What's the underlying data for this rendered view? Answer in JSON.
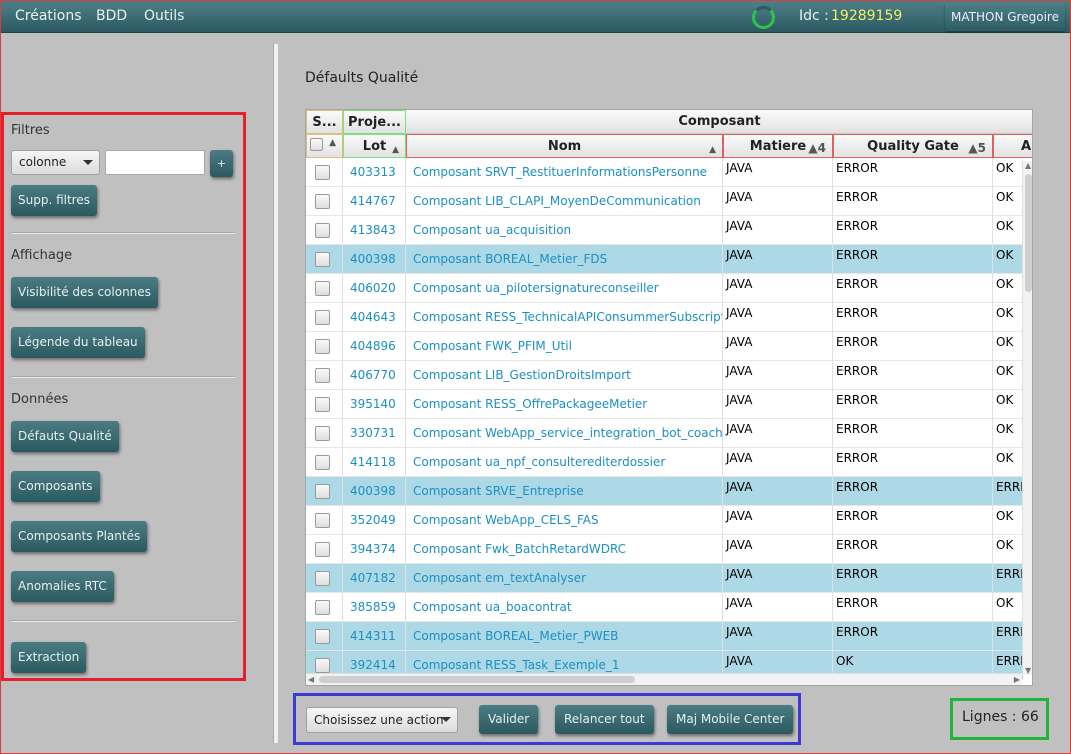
{
  "menubar": {
    "items": [
      "Créations",
      "BDD",
      "Outils"
    ],
    "idc_label": "Idc :",
    "idc_value": "19289159",
    "user": "MATHON Gregoire"
  },
  "sidebar": {
    "filters_title": "Filtres",
    "column_select_value": "colonne",
    "filter_text_value": "",
    "add_filter_label": "+",
    "remove_filters_label": "Supp. filtres",
    "display_title": "Affichage",
    "columns_visibility_label": "Visibilité des colonnes",
    "table_legend_label": "Légende du tableau",
    "data_title": "Données",
    "nav_quality_defects": "Défauts Qualité",
    "nav_components": "Composants",
    "nav_failed_components": "Composants Plantés",
    "nav_rtc_anomalies": "Anomalies RTC",
    "extraction_label": "Extraction"
  },
  "main": {
    "title": "Défaults Qualité",
    "table": {
      "group_headers": {
        "s": "S...",
        "projet": "Proje...",
        "composant": "Composant"
      },
      "columns": {
        "sort_arrow": "▲",
        "lot": "Lot",
        "lot_sort": "▲",
        "nom": "Nom",
        "nom_sort": "▲",
        "matiere": "Matiere",
        "matiere_sort": "▲4",
        "quality_gate": "Quality Gate",
        "quality_gate_sort": "▲5",
        "next": "A"
      },
      "rows": [
        {
          "lot": "403313",
          "nom": "Composant SRVT_RestituerInformationsPersonne",
          "matiere": "JAVA",
          "qg": "ERROR",
          "next": "OK",
          "selected": false
        },
        {
          "lot": "414767",
          "nom": "Composant LIB_CLAPI_MoyenDeCommunication",
          "matiere": "JAVA",
          "qg": "ERROR",
          "next": "OK",
          "selected": false
        },
        {
          "lot": "413843",
          "nom": "Composant ua_acquisition",
          "matiere": "JAVA",
          "qg": "ERROR",
          "next": "OK",
          "selected": false
        },
        {
          "lot": "400398",
          "nom": "Composant BOREAL_Metier_FDS",
          "matiere": "JAVA",
          "qg": "ERROR",
          "next": "OK",
          "selected": true
        },
        {
          "lot": "406020",
          "nom": "Composant ua_pilotersignatureconseiller",
          "matiere": "JAVA",
          "qg": "ERROR",
          "next": "OK",
          "selected": false
        },
        {
          "lot": "404643",
          "nom": "Composant RESS_TechnicalAPIConsummerSubscription",
          "matiere": "JAVA",
          "qg": "ERROR",
          "next": "OK",
          "selected": false
        },
        {
          "lot": "404896",
          "nom": "Composant FWK_PFIM_Util",
          "matiere": "JAVA",
          "qg": "ERROR",
          "next": "OK",
          "selected": false
        },
        {
          "lot": "406770",
          "nom": "Composant LIB_GestionDroitsImport",
          "matiere": "JAVA",
          "qg": "ERROR",
          "next": "OK",
          "selected": false
        },
        {
          "lot": "395140",
          "nom": "Composant RESS_OffrePackageeMetier",
          "matiere": "JAVA",
          "qg": "ERROR",
          "next": "OK",
          "selected": false
        },
        {
          "lot": "330731",
          "nom": "Composant WebApp_service_integration_bot_coach",
          "matiere": "JAVA",
          "qg": "ERROR",
          "next": "OK",
          "selected": false
        },
        {
          "lot": "414118",
          "nom": "Composant ua_npf_consulterediterdossier",
          "matiere": "JAVA",
          "qg": "ERROR",
          "next": "OK",
          "selected": false
        },
        {
          "lot": "400398",
          "nom": "Composant SRVE_Entreprise",
          "matiere": "JAVA",
          "qg": "ERROR",
          "next": "ERRE",
          "selected": true
        },
        {
          "lot": "352049",
          "nom": "Composant WebApp_CELS_FAS",
          "matiere": "JAVA",
          "qg": "ERROR",
          "next": "OK",
          "selected": false
        },
        {
          "lot": "394374",
          "nom": "Composant Fwk_BatchRetardWDRC",
          "matiere": "JAVA",
          "qg": "ERROR",
          "next": "OK",
          "selected": false
        },
        {
          "lot": "407182",
          "nom": "Composant em_textAnalyser",
          "matiere": "JAVA",
          "qg": "ERROR",
          "next": "ERRE",
          "selected": true
        },
        {
          "lot": "385859",
          "nom": "Composant ua_boacontrat",
          "matiere": "JAVA",
          "qg": "ERROR",
          "next": "OK",
          "selected": false
        },
        {
          "lot": "414311",
          "nom": "Composant BOREAL_Metier_PWEB",
          "matiere": "JAVA",
          "qg": "ERROR",
          "next": "ERRE",
          "selected": true
        },
        {
          "lot": "392414",
          "nom": "Composant RESS_Task_Exemple_1",
          "matiere": "JAVA",
          "qg": "OK",
          "next": "ERRE",
          "selected": true
        }
      ]
    },
    "action_select_value": "Choisissez une action",
    "validate_label": "Valider",
    "rerun_all_label": "Relancer tout",
    "maj_mobile_center_label": "Maj Mobile Center",
    "rows_count": "Lignes : 66"
  },
  "colors": {
    "accent": "#2f5d64",
    "selected_row": "#add8e6",
    "link": "#1c8fc4",
    "idc_value": "#f0f060",
    "highlight_red": "#e5202a",
    "highlight_blue": "#3b3bd1",
    "highlight_green": "#21b33c"
  }
}
